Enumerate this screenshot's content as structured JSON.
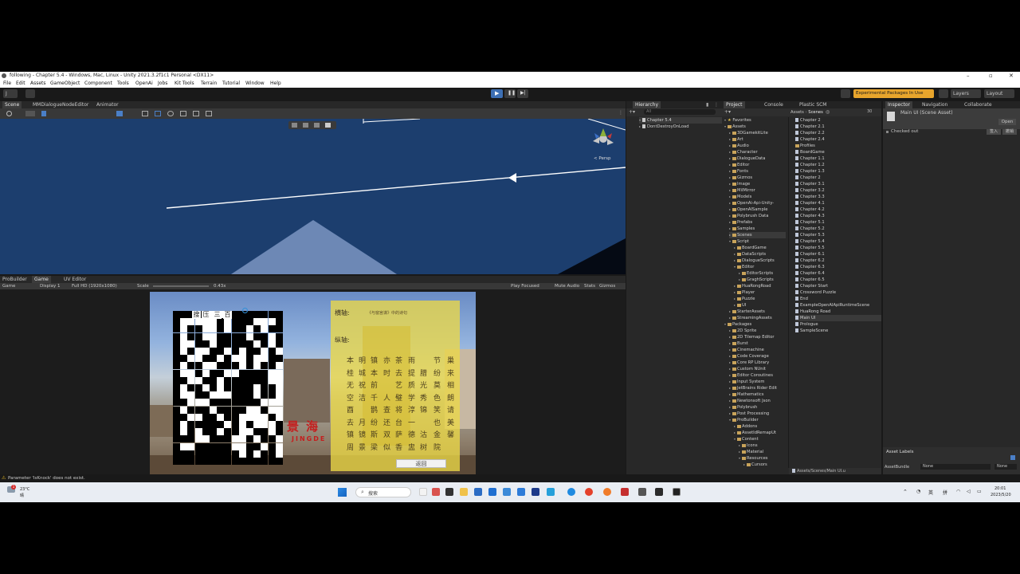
{
  "window": {
    "title": "following - Chapter 5.4 - Windows, Mac, Linux - Unity 2021.3.2f1c1 Personal <DX11>"
  },
  "menu": [
    "File",
    "Edit",
    "Assets",
    "GameObject",
    "Component",
    "Tools",
    "OpenAi",
    "Jobs",
    "Kit Tools",
    "Terrain",
    "Tutorial",
    "Window",
    "Help"
  ],
  "toolbar": {
    "account": "J",
    "experimental_badge": "Experimental Packages In Use",
    "layers_label": "Layers",
    "layout_label": "Layout"
  },
  "scene_panel": {
    "tabs": [
      "Scene",
      "MMDialogueNodeEditor",
      "Animator"
    ],
    "persp_label": "< Persp"
  },
  "game_panel": {
    "tabs": [
      "ProBuilder",
      "Game",
      "UV Editor"
    ],
    "mode": "Game",
    "display": "Display 1",
    "resolution": "Full HD (1920x1080)",
    "scale_label": "Scale",
    "scale_value": "0.43x",
    "play_focused": "Play Focused",
    "mute_audio": "Mute Audio",
    "stats": "Stats",
    "gizmos": "Gizmos"
  },
  "game": {
    "horizontal_chars": [
      "搜",
      "压",
      "三",
      "百"
    ],
    "h_label": "横轴:",
    "h_hint": "《与窗宫谋》中的诗句",
    "v_label": "纵轴:",
    "v_rows": [
      [
        "本",
        "明",
        "镇",
        "亦",
        "茶",
        "雨",
        "",
        "节",
        "巢"
      ],
      [
        "桂",
        "城",
        "本",
        "时",
        "去",
        "提",
        "腊",
        "纷",
        "来"
      ],
      [
        "无",
        "祝",
        "前",
        "",
        "艺",
        "质",
        "光",
        "莫",
        "相"
      ],
      [
        "空",
        "洁",
        "千",
        "人",
        "璧",
        "学",
        "秀",
        "色",
        "朗"
      ],
      [
        "酉",
        "",
        "鹊",
        "查",
        "将",
        "淳",
        "锦",
        "笑",
        "请"
      ],
      [
        "去",
        "月",
        "纷",
        "还",
        "台",
        "一",
        "",
        "也",
        "美"
      ],
      [
        "镇",
        "镜",
        "斯",
        "双",
        "萨",
        "德",
        "沽",
        "金",
        "馨"
      ],
      [
        "周",
        "景",
        "梁",
        "似",
        "香",
        "盅",
        "树",
        "院",
        ""
      ]
    ],
    "sign_chars": [
      "景",
      "海"
    ],
    "sign_latin": "JINGDE",
    "back_button": "返回"
  },
  "hierarchy": {
    "tab": "Hierarchy",
    "search_placeholder": "All",
    "items": [
      "Chapter 5.4",
      "DontDestroyOnLoad"
    ]
  },
  "project": {
    "tabs": [
      "Project",
      "Console",
      "Plastic SCM"
    ],
    "count": "30",
    "breadcrumb": [
      "Assets",
      "Scenes"
    ],
    "favorites": "Favorites",
    "tree": [
      {
        "label": "Assets",
        "depth": 0,
        "open": true
      },
      {
        "label": "3DGamekitLite",
        "depth": 1
      },
      {
        "label": "Art",
        "depth": 1
      },
      {
        "label": "Audio",
        "depth": 1
      },
      {
        "label": "Character",
        "depth": 1
      },
      {
        "label": "DialogueData",
        "depth": 1
      },
      {
        "label": "Editor",
        "depth": 1
      },
      {
        "label": "Fonts",
        "depth": 1
      },
      {
        "label": "Gizmos",
        "depth": 1
      },
      {
        "label": "Image",
        "depth": 1
      },
      {
        "label": "MilMirror",
        "depth": 1
      },
      {
        "label": "Models",
        "depth": 1
      },
      {
        "label": "OpenAi-Api-Unity-",
        "depth": 1
      },
      {
        "label": "OpenAISample",
        "depth": 1
      },
      {
        "label": "Polybrush Data",
        "depth": 1
      },
      {
        "label": "Prefabs",
        "depth": 1
      },
      {
        "label": "Samples",
        "depth": 1
      },
      {
        "label": "Scenes",
        "depth": 1,
        "selected": true
      },
      {
        "label": "Script",
        "depth": 1,
        "open": true
      },
      {
        "label": "BoardGame",
        "depth": 2
      },
      {
        "label": "DataScripts",
        "depth": 2
      },
      {
        "label": "DialogueScripts",
        "depth": 2
      },
      {
        "label": "Editor",
        "depth": 2,
        "open": true
      },
      {
        "label": "EditorScripts",
        "depth": 3
      },
      {
        "label": "GraghScripts",
        "depth": 3
      },
      {
        "label": "HuaRongRoad",
        "depth": 2
      },
      {
        "label": "Player",
        "depth": 2
      },
      {
        "label": "Puzzle",
        "depth": 2
      },
      {
        "label": "UI",
        "depth": 2
      },
      {
        "label": "StarterAssets",
        "depth": 1
      },
      {
        "label": "StreamingAssets",
        "depth": 1
      },
      {
        "label": "Packages",
        "depth": 0,
        "open": true
      },
      {
        "label": "2D Sprite",
        "depth": 1
      },
      {
        "label": "2D Tilemap Editor",
        "depth": 1
      },
      {
        "label": "Burst",
        "depth": 1
      },
      {
        "label": "Cinemachine",
        "depth": 1
      },
      {
        "label": "Code Coverage",
        "depth": 1
      },
      {
        "label": "Core RP Library",
        "depth": 1
      },
      {
        "label": "Custom NUnit",
        "depth": 1
      },
      {
        "label": "Editor Coroutines",
        "depth": 1
      },
      {
        "label": "Input System",
        "depth": 1
      },
      {
        "label": "JetBrains Rider Edit",
        "depth": 1
      },
      {
        "label": "Mathematics",
        "depth": 1
      },
      {
        "label": "Newtonsoft Json",
        "depth": 1
      },
      {
        "label": "Polybrush",
        "depth": 1
      },
      {
        "label": "Post Processing",
        "depth": 1
      },
      {
        "label": "ProBuilder",
        "depth": 1,
        "open": true
      },
      {
        "label": "Addons",
        "depth": 2
      },
      {
        "label": "AssetIdRemapUt",
        "depth": 2
      },
      {
        "label": "Content",
        "depth": 2,
        "open": true
      },
      {
        "label": "Icons",
        "depth": 3
      },
      {
        "label": "Material",
        "depth": 3
      },
      {
        "label": "Resources",
        "depth": 3,
        "open": true
      },
      {
        "label": "Cursors",
        "depth": 4
      }
    ],
    "scenes": [
      "Chapter 2",
      "Chapter 2.1",
      "Chapter 2.2",
      "Chapter 2.4",
      "Profiles",
      "BoardGame",
      "Chapter 1.1",
      "Chapter 1.2",
      "Chapter 1.3",
      "Chapter 2",
      "Chapter 3.1",
      "Chapter 3.2",
      "Chapter 3.3",
      "Chapter 4.1",
      "Chapter 4.2",
      "Chapter 4.3",
      "Chapter 5.1",
      "Chapter 5.2",
      "Chapter 5.3",
      "Chapter 5.4",
      "Chapter 5.5",
      "Chapter 6.1",
      "Chapter 6.2",
      "Chapter 6.3",
      "Chapter 6.4",
      "Chapter 6.5",
      "Chapter Start",
      "Crossword Puzzle",
      "End",
      "ExampleOpenAIApiRuntimeScene",
      "HuaRong Road",
      "Main UI",
      "Prologue",
      "SampleScene"
    ],
    "selected_scene": "Main UI",
    "footer_path": "Assets/Scenes/Main UI.u"
  },
  "inspector": {
    "tabs": [
      "Inspector",
      "Navigation",
      "Collaborate"
    ],
    "asset_title": "Main UI (Scene Asset)",
    "open_button": "Open",
    "checked_out": "Checked out",
    "btn1": "签入",
    "btn2": "撤销",
    "asset_labels": "Asset Labels",
    "asset_bundle_label": "AssetBundle",
    "asset_bundle_value": "None",
    "asset_bundle_variant": "None"
  },
  "status": {
    "warning": "Parameter 'IsKnock' does not exist."
  },
  "taskbar": {
    "weather_temp": "23°C",
    "weather_desc": "晴",
    "search_label": "搜索",
    "ime_lang": "英",
    "ime_mode": "拼",
    "time": "20:01",
    "date": "2023/5/20",
    "notification_count": "1"
  },
  "colors": {
    "scene_bg": "#1c3e6e",
    "panel_bg": "#282828",
    "window_bg": "#191919",
    "accent_blue": "#2f5f9e",
    "exp_badge": "#e8a52c"
  }
}
